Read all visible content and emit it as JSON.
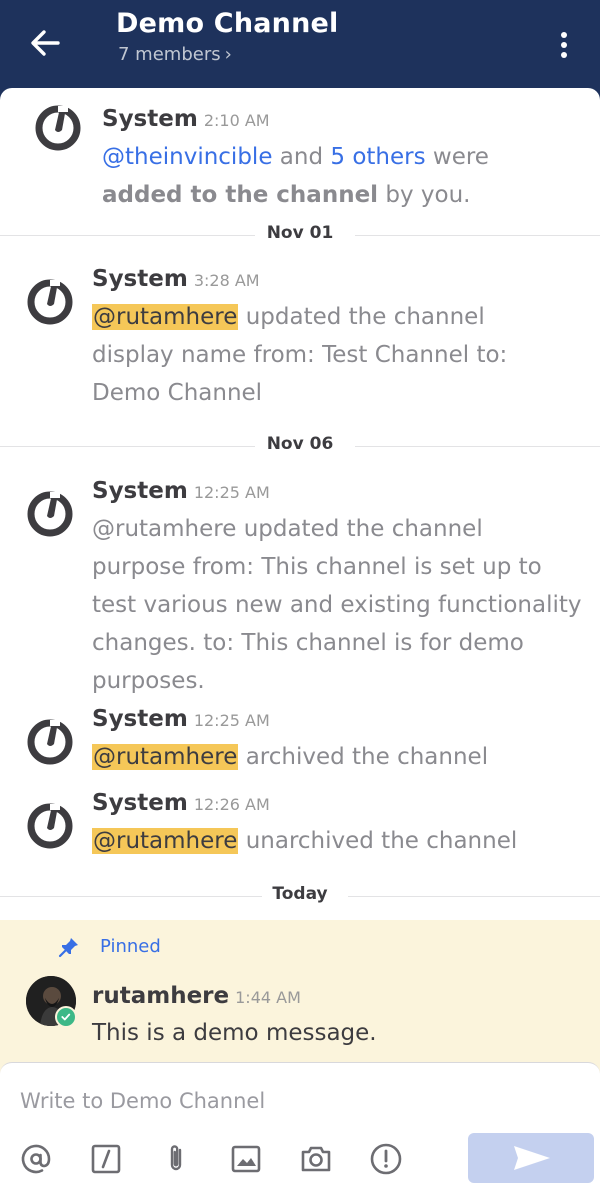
{
  "header": {
    "title": "Demo Channel",
    "members": "7 members",
    "members_chevron": "›",
    "back_icon": "back-arrow-icon",
    "menu_icon": "kebab-menu-icon",
    "background_color": "#1e325c"
  },
  "posts": [
    {
      "user": "System",
      "time": "2:10 AM",
      "segments": {
        "mention1": "@theinvincible",
        "t1": " and ",
        "mention2": "5 others",
        "t2": " were ",
        "bold": "added to the channel",
        "t3": " by you."
      }
    },
    {
      "user": "System",
      "time": "3:28 AM",
      "mention": "@rutamhere",
      "text": " updated the channel display name from: Test Channel to: Demo Channel"
    },
    {
      "user": "System",
      "time": "12:25 AM",
      "text": "@rutamhere updated the channel purpose from: This channel is set up to test various new and existing functionality changes. to: This channel is for demo purposes."
    },
    {
      "user": "System",
      "time": "12:25 AM",
      "mention": "@rutamhere",
      "text": " archived the channel"
    },
    {
      "user": "System",
      "time": "12:26 AM",
      "mention": "@rutamhere",
      "text": " unarchived the channel"
    }
  ],
  "separators": {
    "nov01": "Nov 01",
    "nov06": "Nov 06",
    "today": "Today"
  },
  "pinned_post": {
    "pinned_label": "Pinned",
    "user": "rutamhere",
    "time": "1:44 AM",
    "message": "This is a demo message.",
    "status": "online",
    "highlight_color": "#fbf4dc"
  },
  "composer": {
    "placeholder": "Write to Demo Channel",
    "tools": [
      "at-mention-icon",
      "slash-command-icon",
      "attachment-icon",
      "image-icon",
      "camera-icon",
      "priority-icon"
    ],
    "send_icon": "send-icon"
  },
  "colors": {
    "link": "#386fe5",
    "mention_highlight": "#f5c758"
  }
}
